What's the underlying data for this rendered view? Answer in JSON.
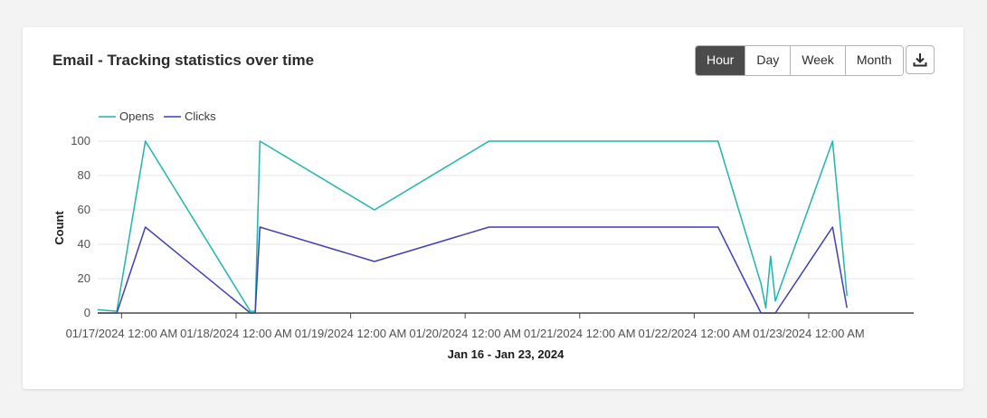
{
  "card": {
    "title": "Email - Tracking statistics over time",
    "granularity_options": [
      "Hour",
      "Day",
      "Week",
      "Month"
    ],
    "selected_granularity": "Hour",
    "download_icon": "download-icon"
  },
  "chart_data": {
    "type": "line",
    "xlabel": "Jan 16 - Jan 23, 2024",
    "ylabel": "Count",
    "ylim": [
      0,
      100
    ],
    "yticks": [
      0,
      20,
      40,
      60,
      80,
      100
    ],
    "xlim": [
      "2024-01-16T19:00",
      "2024-01-23T22:00"
    ],
    "xticks": [
      {
        "t": "2024-01-17T00:00",
        "label": "01/17/2024 12:00 AM"
      },
      {
        "t": "2024-01-18T00:00",
        "label": "01/18/2024 12:00 AM"
      },
      {
        "t": "2024-01-19T00:00",
        "label": "01/19/2024 12:00 AM"
      },
      {
        "t": "2024-01-20T00:00",
        "label": "01/20/2024 12:00 AM"
      },
      {
        "t": "2024-01-21T00:00",
        "label": "01/21/2024 12:00 AM"
      },
      {
        "t": "2024-01-22T00:00",
        "label": "01/22/2024 12:00 AM"
      },
      {
        "t": "2024-01-23T00:00",
        "label": "01/23/2024 12:00 AM"
      }
    ],
    "grid": true,
    "legend_position": "top-left",
    "series": [
      {
        "name": "Opens",
        "color": "#1fb5ad",
        "points": [
          [
            "2024-01-16T19:00",
            2
          ],
          [
            "2024-01-16T23:00",
            1
          ],
          [
            "2024-01-17T05:00",
            100
          ],
          [
            "2024-01-18T03:00",
            1
          ],
          [
            "2024-01-18T04:00",
            1
          ],
          [
            "2024-01-18T05:00",
            100
          ],
          [
            "2024-01-19T05:00",
            60
          ],
          [
            "2024-01-20T05:00",
            100
          ],
          [
            "2024-01-22T05:00",
            100
          ],
          [
            "2024-01-22T14:00",
            17
          ],
          [
            "2024-01-22T15:00",
            3
          ],
          [
            "2024-01-22T16:00",
            33
          ],
          [
            "2024-01-22T17:00",
            7
          ],
          [
            "2024-01-23T05:00",
            100
          ],
          [
            "2024-01-23T08:00",
            10
          ]
        ]
      },
      {
        "name": "Clicks",
        "color": "#3f3fb8",
        "points": [
          [
            "2024-01-16T19:00",
            0
          ],
          [
            "2024-01-16T23:00",
            0
          ],
          [
            "2024-01-17T05:00",
            50
          ],
          [
            "2024-01-18T03:00",
            0
          ],
          [
            "2024-01-18T04:00",
            0
          ],
          [
            "2024-01-18T05:00",
            50
          ],
          [
            "2024-01-19T05:00",
            30
          ],
          [
            "2024-01-20T05:00",
            50
          ],
          [
            "2024-01-22T05:00",
            50
          ],
          [
            "2024-01-22T14:00",
            0
          ],
          [
            "2024-01-22T17:00",
            0
          ],
          [
            "2024-01-23T05:00",
            50
          ],
          [
            "2024-01-23T08:00",
            3
          ]
        ]
      }
    ]
  }
}
